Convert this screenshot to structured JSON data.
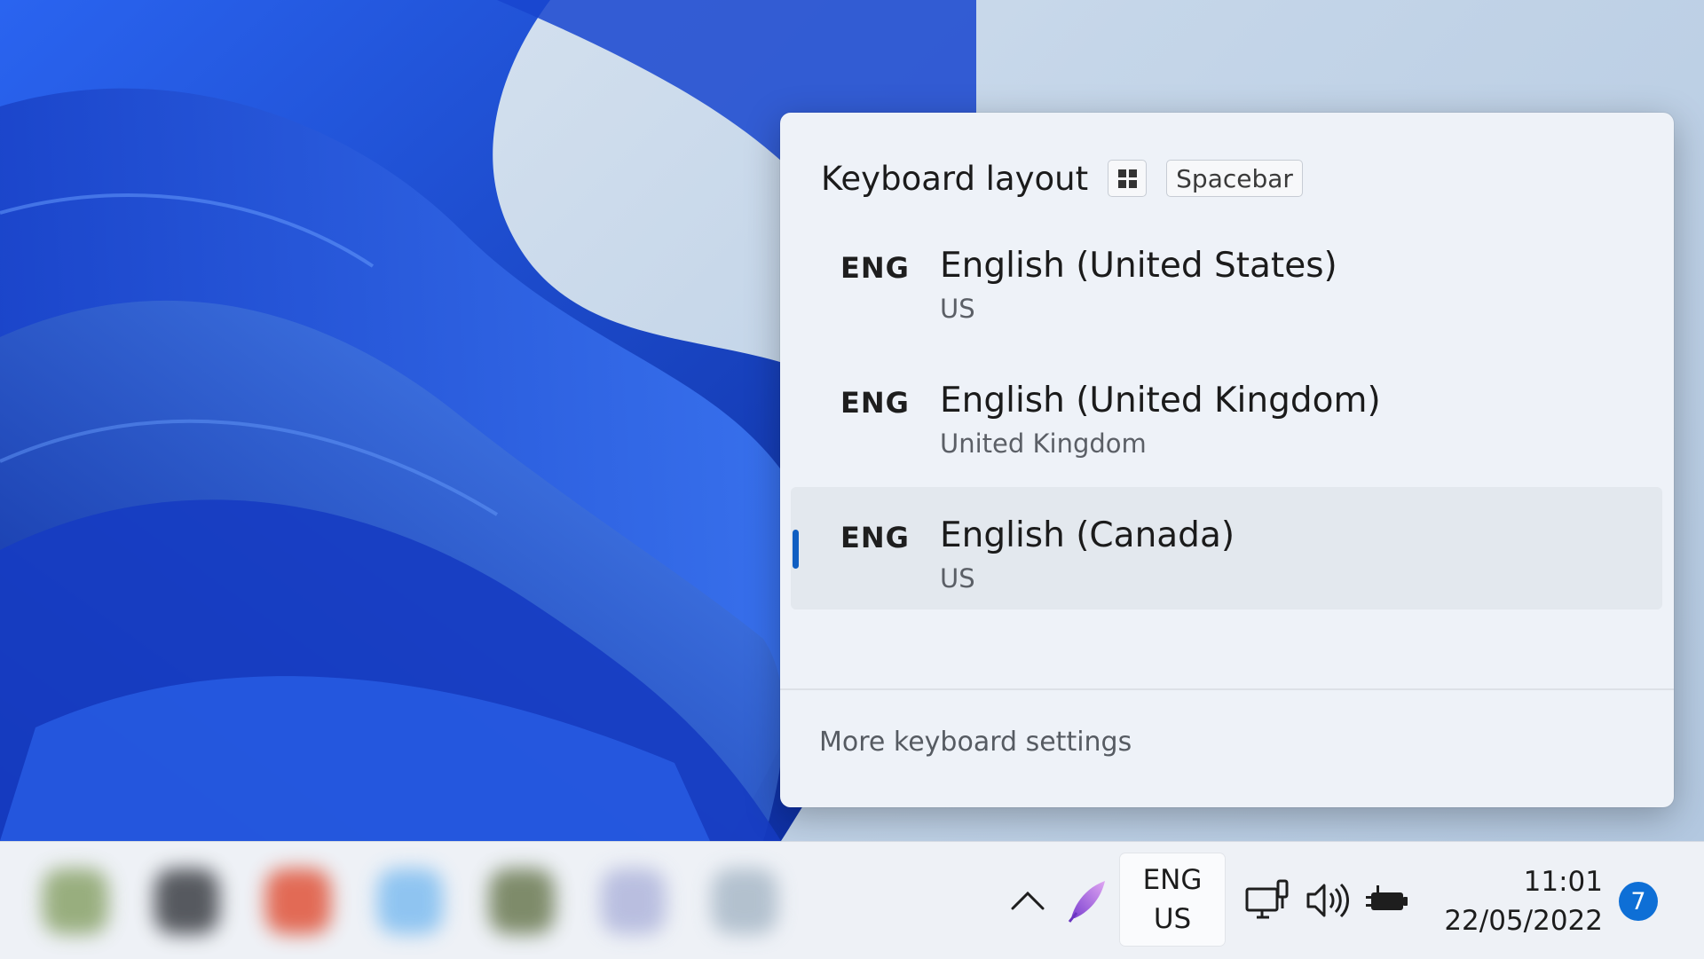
{
  "flyout": {
    "title": "Keyboard layout",
    "shortcut_keys": [
      "Spacebar"
    ],
    "items": [
      {
        "abbr": "ENG",
        "name": "English (United States)",
        "layout": "US",
        "selected": false
      },
      {
        "abbr": "ENG",
        "name": "English (United Kingdom)",
        "layout": "United Kingdom",
        "selected": false
      },
      {
        "abbr": "ENG",
        "name": "English (Canada)",
        "layout": "US",
        "selected": true
      }
    ],
    "more_settings_label": "More keyboard settings"
  },
  "taskbar": {
    "language": {
      "line1": "ENG",
      "line2": "US"
    },
    "clock": {
      "time": "11:01",
      "date": "22/05/2022"
    },
    "notification_count": "7",
    "tray_icons": [
      "chevron-up-icon",
      "pen-icon",
      "network-icon",
      "volume-icon",
      "battery-icon"
    ]
  },
  "colors": {
    "accent": "#0f5ec2",
    "badge": "#0e6fd6",
    "wallpaper_blue": "#1f4fd6"
  }
}
